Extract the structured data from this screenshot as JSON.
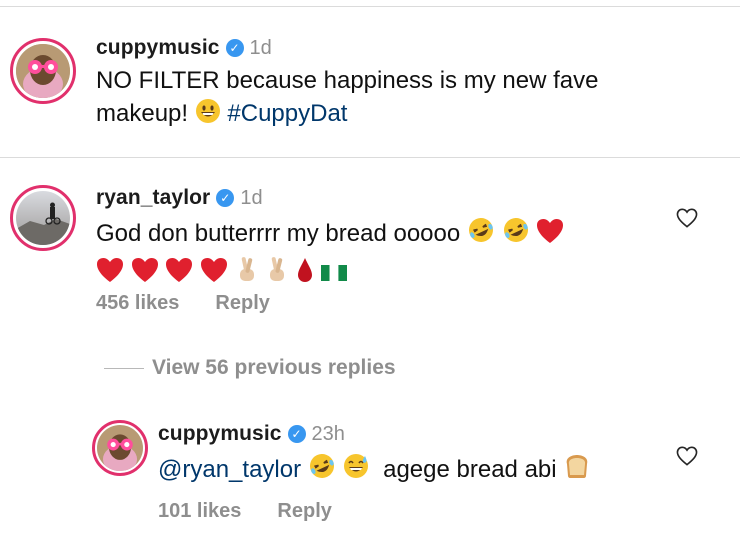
{
  "post": {
    "username": "cuppymusic",
    "verified": true,
    "time": "1d",
    "caption_line1": "NO FILTER because happiness is my new fave",
    "caption_line2_text": "makeup!",
    "caption_emoji": "grinning-face",
    "hashtag": "#CuppyDat"
  },
  "comment": {
    "username": "ryan_taylor",
    "verified": true,
    "time": "1d",
    "text": "God don butterrrr my bread ooooo",
    "emojis_line1": [
      "rolling-on-floor-laughing",
      "rolling-on-floor-laughing",
      "red-heart"
    ],
    "emojis_line2": [
      "red-heart",
      "red-heart",
      "red-heart",
      "red-heart",
      "crossed-fingers",
      "crossed-fingers",
      "drop-of-blood",
      "flag-nigeria"
    ],
    "likes": "456 likes",
    "reply_label": "Reply"
  },
  "view_replies": "View 56 previous replies",
  "reply": {
    "username": "cuppymusic",
    "verified": true,
    "time": "23h",
    "mention": "@ryan_taylor",
    "text": "agege bread abi",
    "emojis": [
      "rolling-on-floor-laughing",
      "grinning-sweat"
    ],
    "trailing_emoji": "bread",
    "likes": "101 likes",
    "reply_label": "Reply"
  },
  "colors": {
    "link": "#00376b",
    "secondary_text": "#8e8e8e",
    "verified_badge": "#3897f0",
    "story_ring": "#e1306c"
  }
}
